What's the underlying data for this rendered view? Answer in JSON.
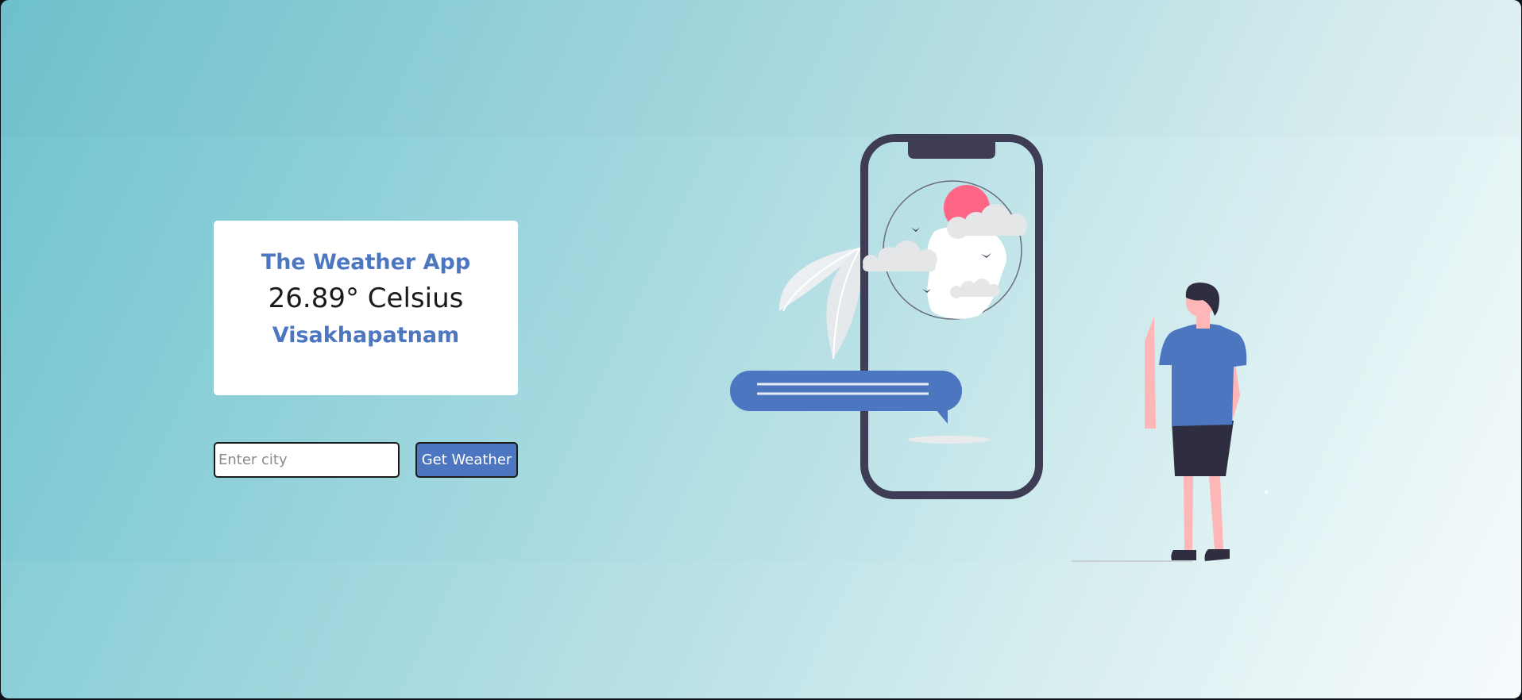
{
  "weather_card": {
    "title": "The Weather App",
    "temperature": "26.89° Celsius",
    "city": "Visakhapatnam"
  },
  "search": {
    "placeholder": "Enter city",
    "value": "",
    "button_label": "Get Weather"
  },
  "colors": {
    "accent": "#4c76bf",
    "sun": "#ff6584",
    "phone_frame": "#3f3d56",
    "skin": "#ffb6b6",
    "hair": "#2f2e41"
  },
  "icons": [
    "phone-illustration",
    "person-illustration",
    "chat-bubble-illustration",
    "leaf-illustration",
    "sun-illustration",
    "cloud-illustration",
    "bird-illustration"
  ]
}
